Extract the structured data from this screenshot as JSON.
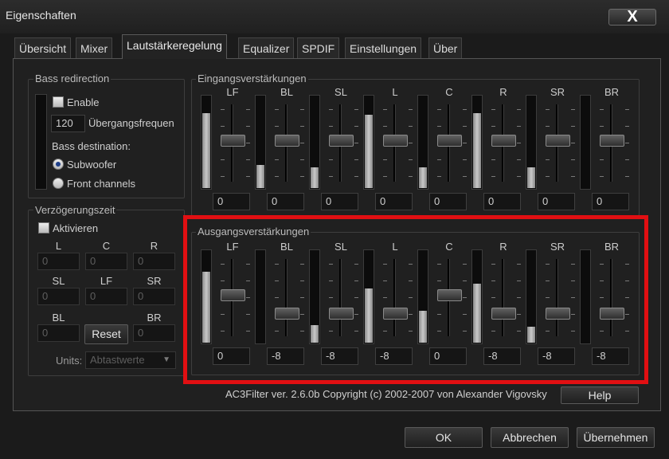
{
  "window": {
    "title": "Eigenschaften",
    "close_glyph": "X"
  },
  "tabs": [
    "Übersicht",
    "Mixer",
    "Lautstärkeregelung",
    "Equalizer",
    "SPDIF",
    "Einstellungen",
    "Über"
  ],
  "active_tab": "Lautstärkeregelung",
  "bass": {
    "legend": "Bass redirection",
    "enable_label": "Enable",
    "enable_checked": false,
    "frequency_value": "120",
    "frequency_label": "Übergangsfrequen",
    "destination_label": "Bass destination:",
    "options": [
      "Subwoofer",
      "Front channels"
    ],
    "selected_option": "Subwoofer"
  },
  "delay": {
    "legend": "Verzögerungszeit",
    "activate_label": "Aktivieren",
    "activate_checked": false,
    "labels": [
      "L",
      "C",
      "R",
      "SL",
      "LF",
      "SR",
      "BL",
      "BR"
    ],
    "values": [
      "0",
      "0",
      "0",
      "0",
      "0",
      "0",
      "0",
      "0"
    ],
    "reset_label": "Reset",
    "units_label": "Units:",
    "units_value": "Abtastwerte"
  },
  "input_gains": {
    "legend": "Eingangsverstärkungen",
    "channels": [
      "LF",
      "BL",
      "SL",
      "L",
      "C",
      "R",
      "SR",
      "BR"
    ],
    "values": [
      "0",
      "0",
      "0",
      "0",
      "0",
      "0",
      "0",
      "0"
    ],
    "meter_levels": [
      0.8,
      0.25,
      0.22,
      0.79,
      0.22,
      0.8,
      0.22,
      0.0
    ]
  },
  "output_gains": {
    "legend": "Ausgangsverstärkungen",
    "channels": [
      "LF",
      "BL",
      "SL",
      "L",
      "C",
      "R",
      "SR",
      "BR"
    ],
    "values": [
      "0",
      "-8",
      "-8",
      "-8",
      "0",
      "-8",
      "-8",
      "-8"
    ],
    "meter_levels": [
      0.76,
      0.0,
      0.19,
      0.58,
      0.34,
      0.63,
      0.17,
      0.0
    ]
  },
  "footer": {
    "copyright": "AC3Filter ver. 2.6.0b Copyright (c) 2002-2007 von Alexander Vigovsky",
    "help_label": "Help"
  },
  "buttons": {
    "ok": "OK",
    "cancel": "Abbrechen",
    "apply": "Übernehmen"
  },
  "colors": {
    "highlight": "#e10f12",
    "background": "#1b1b1b",
    "meter_fill": "#bdbdbd"
  }
}
